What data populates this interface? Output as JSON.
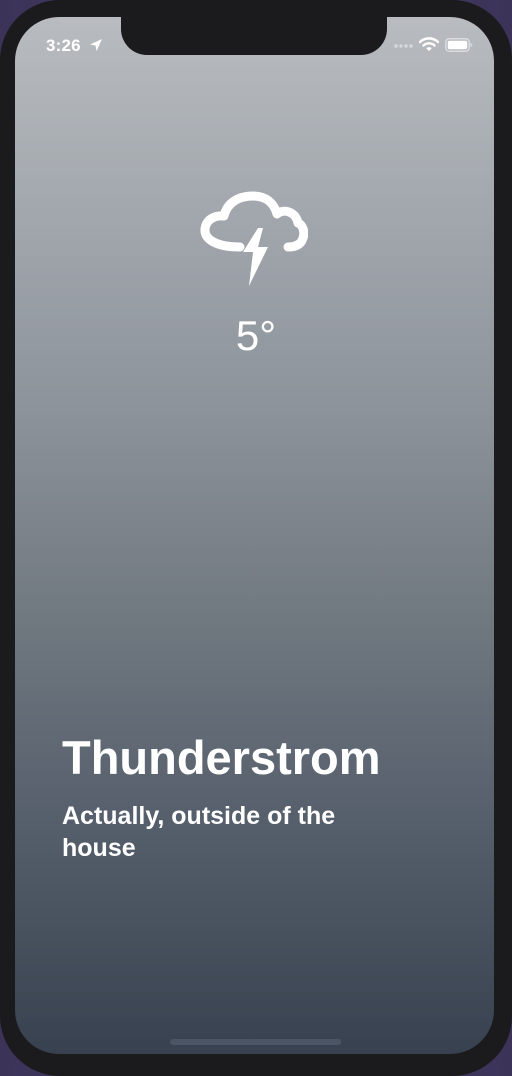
{
  "status_bar": {
    "time": "3:26",
    "location_icon": "location-arrow-icon",
    "signal_icon": "cellular-signal-icon",
    "wifi_icon": "wifi-icon",
    "battery_icon": "battery-icon"
  },
  "weather": {
    "icon": "thunderstorm-cloud-icon",
    "temperature": "5°",
    "condition": "Thunderstrom",
    "description": "Actually, outside of the house"
  },
  "colors": {
    "gradient_top": "#b8bcc0",
    "gradient_bottom": "#38414f",
    "text": "#ffffff",
    "frame": "#1b1b1d"
  }
}
